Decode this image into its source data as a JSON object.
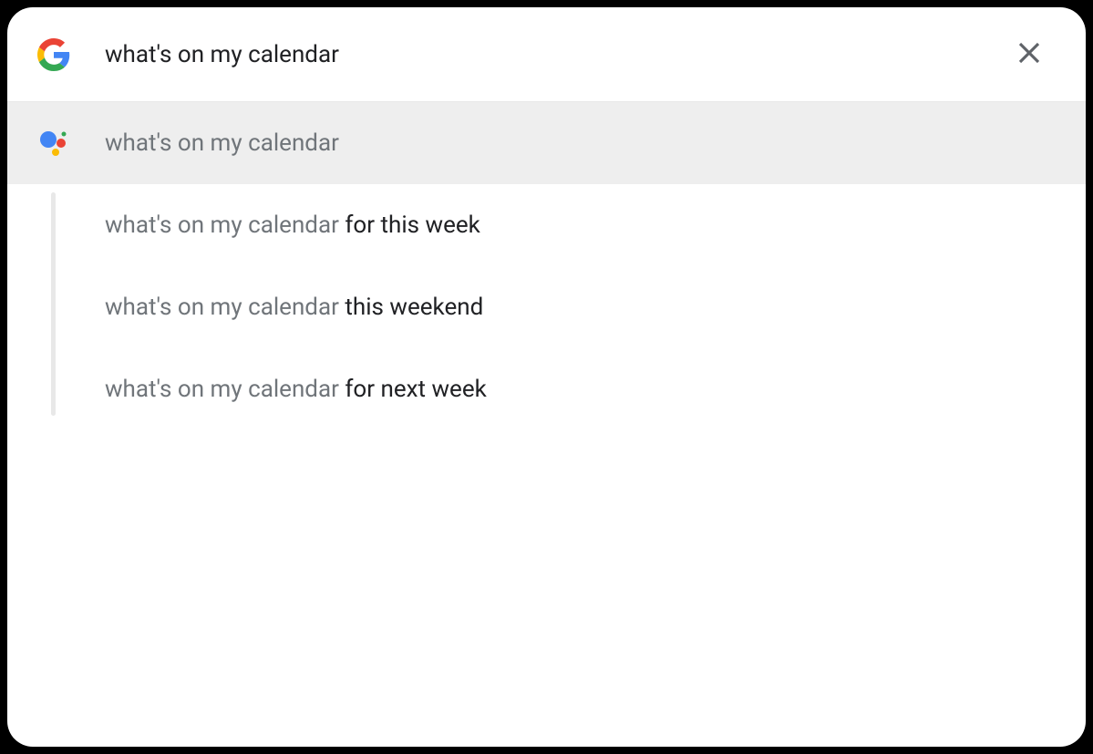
{
  "search": {
    "query": "what's on my calendar"
  },
  "suggestions": [
    {
      "prefix": "what's on my calendar",
      "suffix": "",
      "highlighted": true,
      "hasAssistantIcon": true
    },
    {
      "prefix": "what's on my calendar ",
      "suffix": "for this week",
      "highlighted": false,
      "hasAssistantIcon": false
    },
    {
      "prefix": "what's on my calendar ",
      "suffix": "this weekend",
      "highlighted": false,
      "hasAssistantIcon": false
    },
    {
      "prefix": "what's on my calendar ",
      "suffix": "for next week",
      "highlighted": false,
      "hasAssistantIcon": false
    }
  ]
}
